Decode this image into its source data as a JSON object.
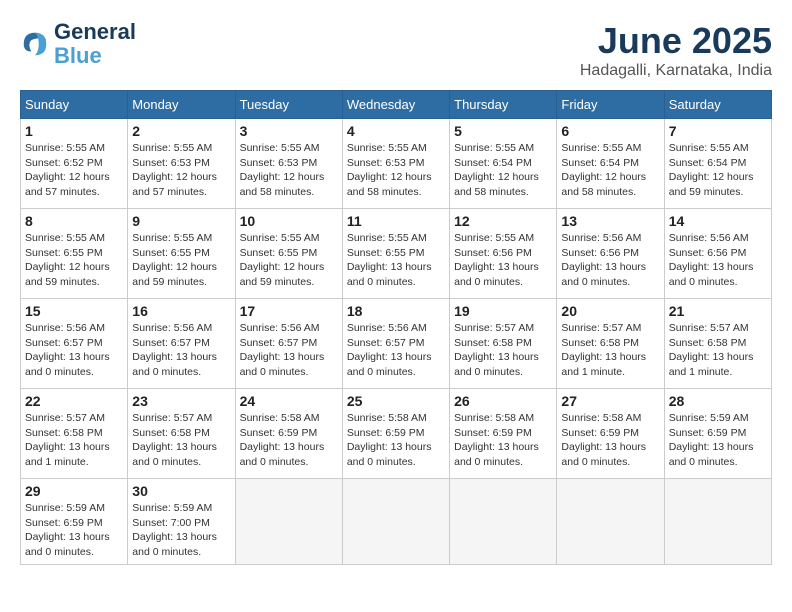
{
  "logo": {
    "line1": "General",
    "line2": "Blue"
  },
  "title": "June 2025",
  "location": "Hadagalli, Karnataka, India",
  "headers": [
    "Sunday",
    "Monday",
    "Tuesday",
    "Wednesday",
    "Thursday",
    "Friday",
    "Saturday"
  ],
  "weeks": [
    [
      {
        "day": "1",
        "info": "Sunrise: 5:55 AM\nSunset: 6:52 PM\nDaylight: 12 hours\nand 57 minutes."
      },
      {
        "day": "2",
        "info": "Sunrise: 5:55 AM\nSunset: 6:53 PM\nDaylight: 12 hours\nand 57 minutes."
      },
      {
        "day": "3",
        "info": "Sunrise: 5:55 AM\nSunset: 6:53 PM\nDaylight: 12 hours\nand 58 minutes."
      },
      {
        "day": "4",
        "info": "Sunrise: 5:55 AM\nSunset: 6:53 PM\nDaylight: 12 hours\nand 58 minutes."
      },
      {
        "day": "5",
        "info": "Sunrise: 5:55 AM\nSunset: 6:54 PM\nDaylight: 12 hours\nand 58 minutes."
      },
      {
        "day": "6",
        "info": "Sunrise: 5:55 AM\nSunset: 6:54 PM\nDaylight: 12 hours\nand 58 minutes."
      },
      {
        "day": "7",
        "info": "Sunrise: 5:55 AM\nSunset: 6:54 PM\nDaylight: 12 hours\nand 59 minutes."
      }
    ],
    [
      {
        "day": "8",
        "info": "Sunrise: 5:55 AM\nSunset: 6:55 PM\nDaylight: 12 hours\nand 59 minutes."
      },
      {
        "day": "9",
        "info": "Sunrise: 5:55 AM\nSunset: 6:55 PM\nDaylight: 12 hours\nand 59 minutes."
      },
      {
        "day": "10",
        "info": "Sunrise: 5:55 AM\nSunset: 6:55 PM\nDaylight: 12 hours\nand 59 minutes."
      },
      {
        "day": "11",
        "info": "Sunrise: 5:55 AM\nSunset: 6:55 PM\nDaylight: 13 hours\nand 0 minutes."
      },
      {
        "day": "12",
        "info": "Sunrise: 5:55 AM\nSunset: 6:56 PM\nDaylight: 13 hours\nand 0 minutes."
      },
      {
        "day": "13",
        "info": "Sunrise: 5:56 AM\nSunset: 6:56 PM\nDaylight: 13 hours\nand 0 minutes."
      },
      {
        "day": "14",
        "info": "Sunrise: 5:56 AM\nSunset: 6:56 PM\nDaylight: 13 hours\nand 0 minutes."
      }
    ],
    [
      {
        "day": "15",
        "info": "Sunrise: 5:56 AM\nSunset: 6:57 PM\nDaylight: 13 hours\nand 0 minutes."
      },
      {
        "day": "16",
        "info": "Sunrise: 5:56 AM\nSunset: 6:57 PM\nDaylight: 13 hours\nand 0 minutes."
      },
      {
        "day": "17",
        "info": "Sunrise: 5:56 AM\nSunset: 6:57 PM\nDaylight: 13 hours\nand 0 minutes."
      },
      {
        "day": "18",
        "info": "Sunrise: 5:56 AM\nSunset: 6:57 PM\nDaylight: 13 hours\nand 0 minutes."
      },
      {
        "day": "19",
        "info": "Sunrise: 5:57 AM\nSunset: 6:58 PM\nDaylight: 13 hours\nand 0 minutes."
      },
      {
        "day": "20",
        "info": "Sunrise: 5:57 AM\nSunset: 6:58 PM\nDaylight: 13 hours\nand 1 minute."
      },
      {
        "day": "21",
        "info": "Sunrise: 5:57 AM\nSunset: 6:58 PM\nDaylight: 13 hours\nand 1 minute."
      }
    ],
    [
      {
        "day": "22",
        "info": "Sunrise: 5:57 AM\nSunset: 6:58 PM\nDaylight: 13 hours\nand 1 minute."
      },
      {
        "day": "23",
        "info": "Sunrise: 5:57 AM\nSunset: 6:58 PM\nDaylight: 13 hours\nand 0 minutes."
      },
      {
        "day": "24",
        "info": "Sunrise: 5:58 AM\nSunset: 6:59 PM\nDaylight: 13 hours\nand 0 minutes."
      },
      {
        "day": "25",
        "info": "Sunrise: 5:58 AM\nSunset: 6:59 PM\nDaylight: 13 hours\nand 0 minutes."
      },
      {
        "day": "26",
        "info": "Sunrise: 5:58 AM\nSunset: 6:59 PM\nDaylight: 13 hours\nand 0 minutes."
      },
      {
        "day": "27",
        "info": "Sunrise: 5:58 AM\nSunset: 6:59 PM\nDaylight: 13 hours\nand 0 minutes."
      },
      {
        "day": "28",
        "info": "Sunrise: 5:59 AM\nSunset: 6:59 PM\nDaylight: 13 hours\nand 0 minutes."
      }
    ],
    [
      {
        "day": "29",
        "info": "Sunrise: 5:59 AM\nSunset: 6:59 PM\nDaylight: 13 hours\nand 0 minutes."
      },
      {
        "day": "30",
        "info": "Sunrise: 5:59 AM\nSunset: 7:00 PM\nDaylight: 13 hours\nand 0 minutes."
      },
      {
        "day": "",
        "info": ""
      },
      {
        "day": "",
        "info": ""
      },
      {
        "day": "",
        "info": ""
      },
      {
        "day": "",
        "info": ""
      },
      {
        "day": "",
        "info": ""
      }
    ]
  ]
}
